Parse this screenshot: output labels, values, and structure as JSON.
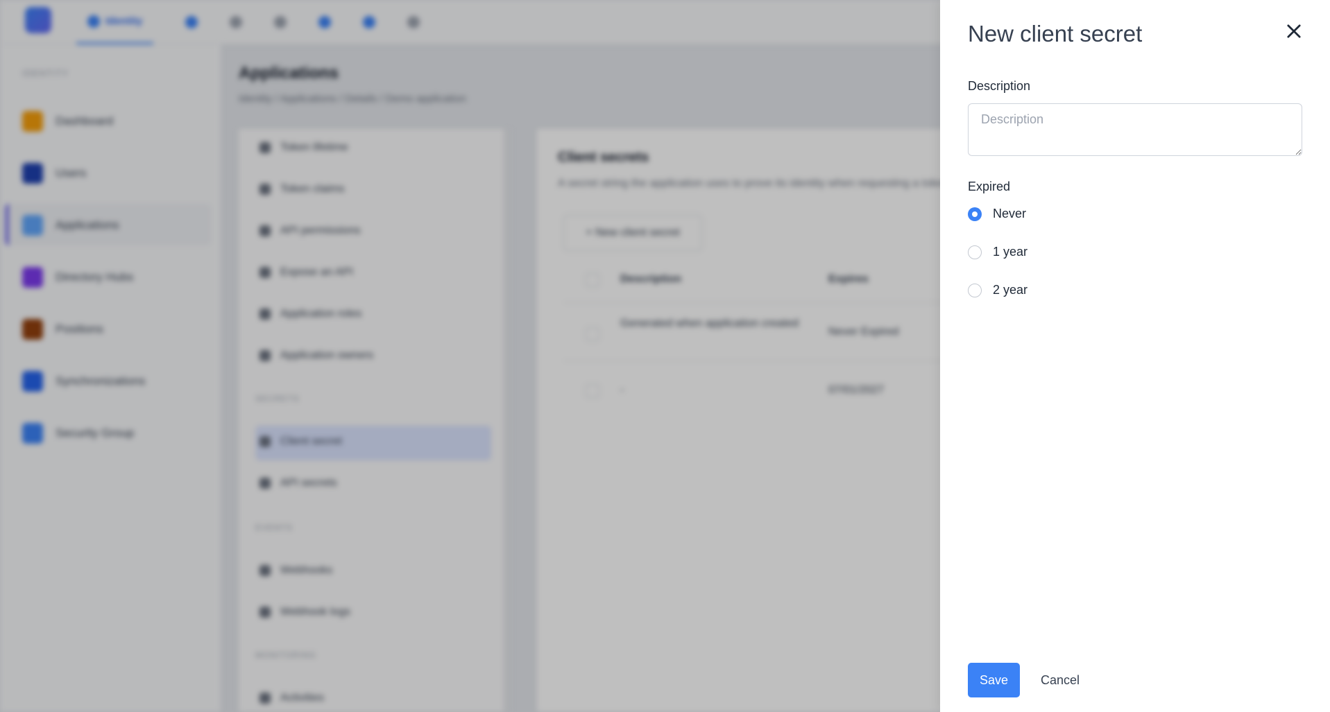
{
  "background": {
    "top_tab_label": "Identity",
    "sidebar": {
      "caption": "IDENTITY",
      "items": [
        {
          "label": "Dashboard",
          "color": "#f59e0b"
        },
        {
          "label": "Users",
          "color": "#1e40af"
        },
        {
          "label": "Applications",
          "color": "#60a5fa"
        },
        {
          "label": "Directory Hubs",
          "color": "#7c3aed"
        },
        {
          "label": "Positions",
          "color": "#92400e"
        },
        {
          "label": "Synchronizations",
          "color": "#2563eb"
        },
        {
          "label": "Security Group",
          "color": "#3b82f6"
        }
      ]
    },
    "page_title": "Applications",
    "breadcrumb": "Identity / Applications / Details / Demo application",
    "menu": {
      "items_top": [
        "Token lifetime",
        "Token claims",
        "API permissions",
        "Expose an API",
        "Application roles",
        "Application owners"
      ],
      "caption_secrets": "SECRETS",
      "items_secrets": [
        "Client secret",
        "API secrets"
      ],
      "caption_events": "EVENTS",
      "items_events": [
        "Webhooks",
        "Webhook logs"
      ],
      "caption_monitoring": "MONITORING",
      "items_monitoring": [
        "Activities"
      ]
    },
    "panel": {
      "title": "Client secrets",
      "description": "A secret string the application uses to prove its identity when requesting a token.",
      "new_button": "+ New client secret",
      "columns": [
        "Description",
        "Expires"
      ],
      "rows": [
        {
          "description": "Generated when application created",
          "expires": "Never Expired"
        },
        {
          "description": "-",
          "expires": "07/01/2027"
        }
      ]
    }
  },
  "drawer": {
    "title": "New client secret",
    "description_label": "Description",
    "description_placeholder": "Description",
    "description_value": "",
    "expired_label": "Expired",
    "options": [
      {
        "label": "Never",
        "checked": true
      },
      {
        "label": "1 year",
        "checked": false
      },
      {
        "label": "2 year",
        "checked": false
      }
    ],
    "save_label": "Save",
    "cancel_label": "Cancel",
    "accent_color": "#3b82f6"
  }
}
